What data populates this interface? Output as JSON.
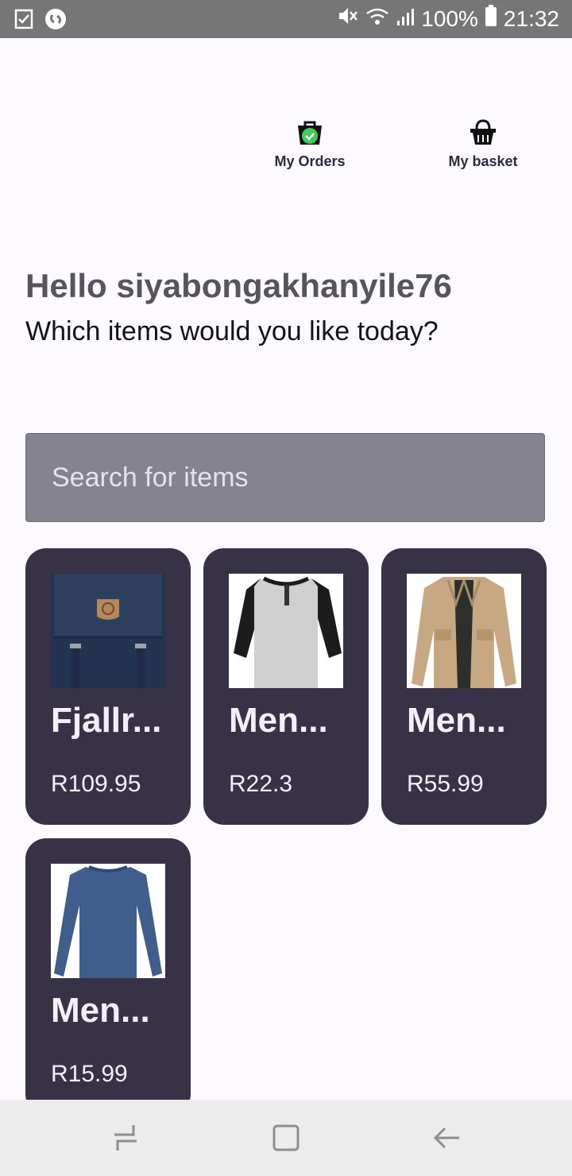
{
  "status_bar": {
    "battery": "100%",
    "time": "21:32",
    "icons": [
      "checklist-icon",
      "shazam-icon",
      "mute-icon",
      "wifi-icon",
      "signal-icon",
      "battery-icon"
    ]
  },
  "top_nav": {
    "orders_label": "My Orders",
    "basket_label": "My basket"
  },
  "greeting": {
    "title": "Hello siyabongakhanyile76",
    "subtitle": "Which items would you like today?"
  },
  "search": {
    "placeholder": "Search for items"
  },
  "products": [
    {
      "name": "Fjallr...",
      "price": "R109.95",
      "image": "navy-backpack"
    },
    {
      "name": "Men...",
      "price": "R22.3",
      "image": "raglan-henley-shirt"
    },
    {
      "name": "Men...",
      "price": "R55.99",
      "image": "khaki-jacket"
    },
    {
      "name": "Men...",
      "price": "R15.99",
      "image": "blue-long-sleeve-shirt"
    }
  ],
  "colors": {
    "card_bg": "#373246",
    "search_bg": "#868391",
    "status_bg": "#767676",
    "accent_check": "#3ecf5a"
  }
}
